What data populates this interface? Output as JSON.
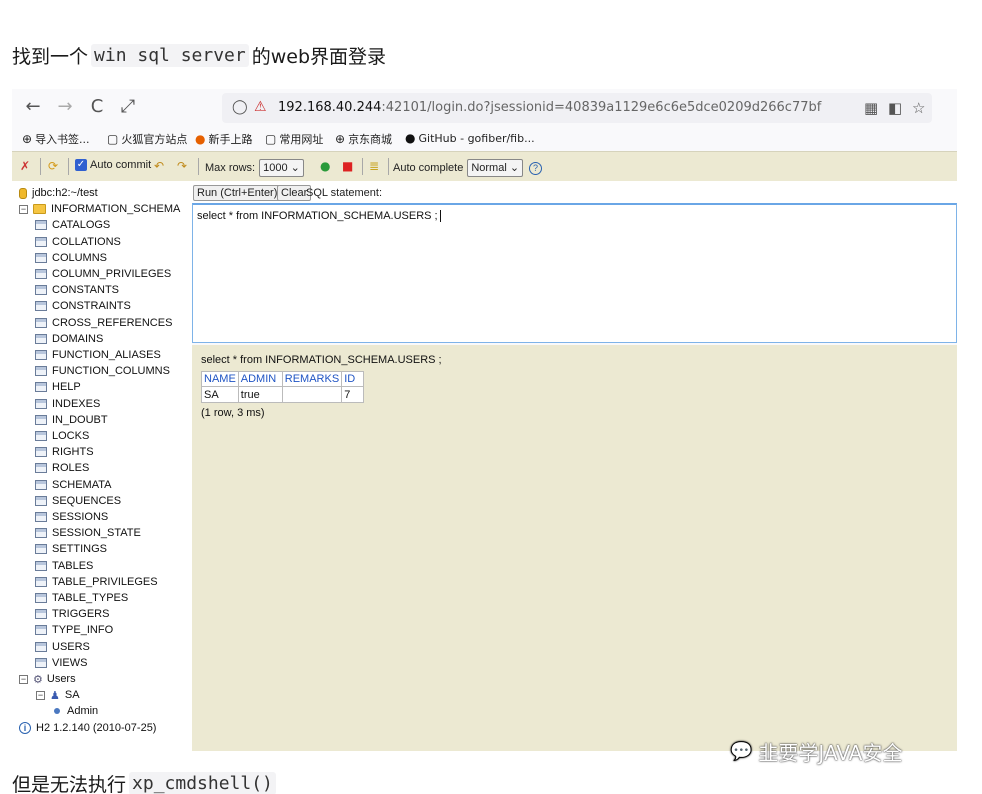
{
  "article": {
    "heading_prefix": "找到一个",
    "heading_code": "win sql server",
    "heading_suffix": "的web界面登录",
    "footer_prefix": "但是无法执行",
    "footer_code": "xp_cmdshell()"
  },
  "browser": {
    "nav": {
      "back": "←",
      "forward": "→",
      "reload": "C",
      "expand": "⤢"
    },
    "url_host": "192.168.40.244",
    "url_rest": ":42101/login.do?jsessionid=40839a1129e6c6e5dce0209d266c77bf",
    "bookmarks": [
      {
        "icon": "⊕",
        "label": "导入书签..."
      },
      {
        "icon": "▢",
        "label": "火狐官方站点"
      },
      {
        "icon": "●",
        "label": "新手上路"
      },
      {
        "icon": "▢",
        "label": "常用网址"
      },
      {
        "icon": "⊕",
        "label": "京东商城"
      },
      {
        "icon": "●",
        "label": "GitHub - gofiber/fib..."
      }
    ]
  },
  "h2": {
    "auto_commit": "Auto commit",
    "max_rows_label": "Max rows:",
    "max_rows_value": "1000",
    "auto_complete_label": "Auto complete",
    "auto_complete_value": "Normal",
    "help": "?",
    "run_button": "Run (Ctrl+Enter)",
    "clear_button": "Clear",
    "sql_statement_label": "SQL statement:",
    "sql_text": "select * from INFORMATION_SCHEMA.USERS ;",
    "tree": {
      "connection": "jdbc:h2:~/test",
      "schema": "INFORMATION_SCHEMA",
      "tables": [
        "CATALOGS",
        "COLLATIONS",
        "COLUMNS",
        "COLUMN_PRIVILEGES",
        "CONSTANTS",
        "CONSTRAINTS",
        "CROSS_REFERENCES",
        "DOMAINS",
        "FUNCTION_ALIASES",
        "FUNCTION_COLUMNS",
        "HELP",
        "INDEXES",
        "IN_DOUBT",
        "LOCKS",
        "RIGHTS",
        "ROLES",
        "SCHEMATA",
        "SEQUENCES",
        "SESSIONS",
        "SESSION_STATE",
        "SETTINGS",
        "TABLES",
        "TABLE_PRIVILEGES",
        "TABLE_TYPES",
        "TRIGGERS",
        "TYPE_INFO",
        "USERS",
        "VIEWS"
      ],
      "users_node": "Users",
      "user_sa": "SA",
      "user_admin": "Admin",
      "version": "H2 1.2.140 (2010-07-25)"
    },
    "result": {
      "query": "select * from INFORMATION_SCHEMA.USERS ;",
      "columns": [
        "NAME",
        "ADMIN",
        "REMARKS",
        "ID"
      ],
      "rows": [
        [
          "SA",
          "true",
          "",
          "7"
        ]
      ],
      "summary": "(1 row, 3 ms)"
    }
  },
  "watermark": "韭要学JAVA安全"
}
